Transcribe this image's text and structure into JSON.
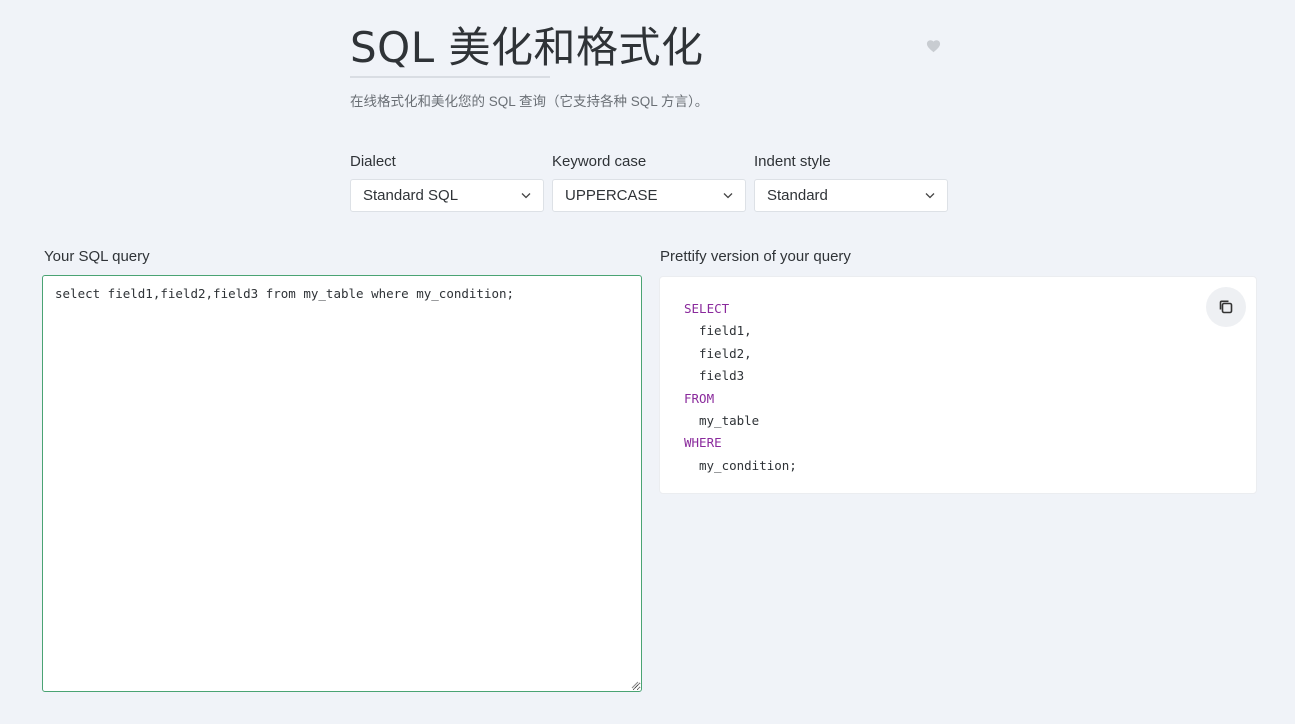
{
  "header": {
    "title": "SQL 美化和格式化",
    "subtitle": "在线格式化和美化您的 SQL 查询（它支持各种 SQL 方言）。"
  },
  "options": {
    "dialect": {
      "label": "Dialect",
      "value": "Standard SQL"
    },
    "keyword_case": {
      "label": "Keyword case",
      "value": "UPPERCASE"
    },
    "indent_style": {
      "label": "Indent style",
      "value": "Standard"
    }
  },
  "input": {
    "label": "Your SQL query",
    "value": "select field1,field2,field3 from my_table where my_condition;"
  },
  "output": {
    "label": "Prettify version of your query",
    "lines": [
      {
        "text": "SELECT",
        "keyword": true
      },
      {
        "text": "field1,",
        "keyword": false
      },
      {
        "text": "field2,",
        "keyword": false
      },
      {
        "text": "field3",
        "keyword": false
      },
      {
        "text": "FROM",
        "keyword": true
      },
      {
        "text": "my_table",
        "keyword": false
      },
      {
        "text": "WHERE",
        "keyword": true
      },
      {
        "text": "my_condition;",
        "keyword": false
      }
    ]
  },
  "colors": {
    "background": "#f0f3f8",
    "keyword": "#8a2a9c",
    "input_border": "#4aa373"
  },
  "icons": {
    "favorite": "heart-icon",
    "copy": "copy-icon",
    "dropdown": "chevron-down-icon"
  }
}
